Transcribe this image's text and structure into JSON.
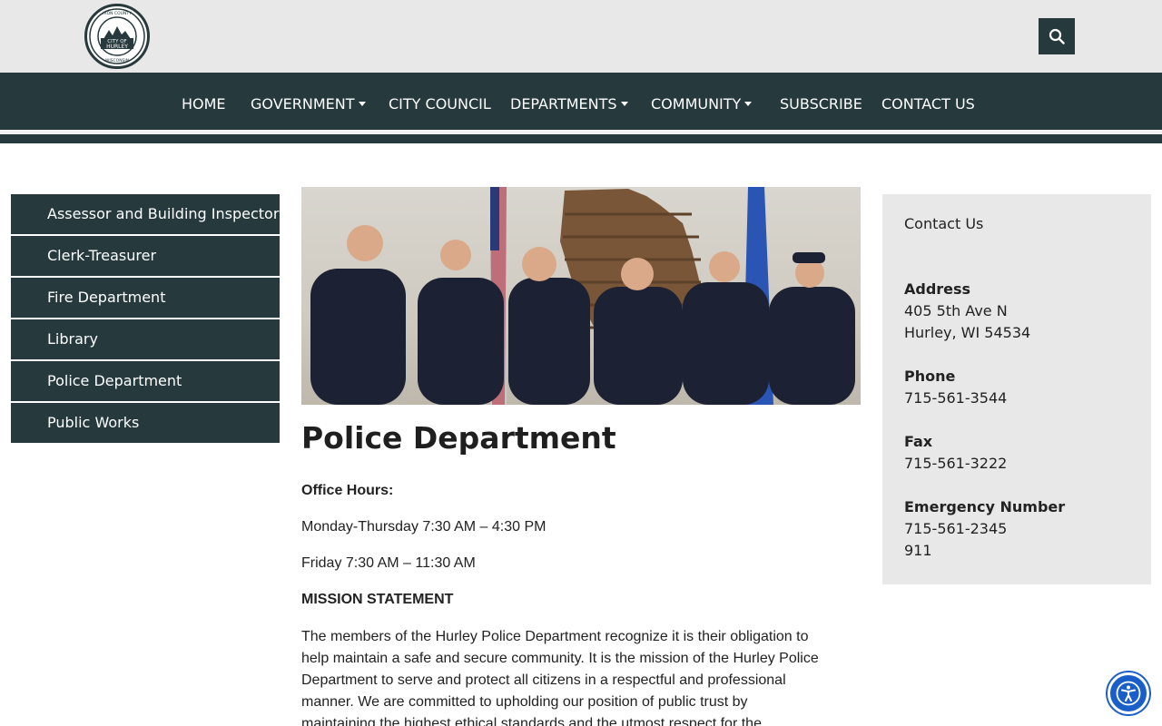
{
  "header": {
    "logo": {
      "top_text": "IRON COUNTY",
      "middle_text_1": "CITY OF",
      "middle_text_2": "HURLEY",
      "bottom_text": "WISCONSIN"
    },
    "search_icon": "search-icon"
  },
  "nav": {
    "items": [
      {
        "label": "HOME",
        "dropdown": false
      },
      {
        "label": "GOVERNMENT",
        "dropdown": true
      },
      {
        "label": "CITY COUNCIL",
        "dropdown": false
      },
      {
        "label": "DEPARTMENTS",
        "dropdown": true
      },
      {
        "label": "COMMUNITY",
        "dropdown": true
      },
      {
        "label": "SUBSCRIBE",
        "dropdown": false
      },
      {
        "label": "CONTACT US",
        "dropdown": false
      }
    ]
  },
  "sidebar": {
    "items": [
      {
        "label": "Assessor and Building Inspector"
      },
      {
        "label": "Clerk-Treasurer"
      },
      {
        "label": "Fire Department"
      },
      {
        "label": "Library"
      },
      {
        "label": "Police Department"
      },
      {
        "label": "Public Works"
      }
    ]
  },
  "main": {
    "title": "Police Department",
    "office_hours_label": "Office Hours:",
    "hours_weekday": "Monday-Thursday 7:30 AM – 4:30 PM",
    "hours_friday": "Friday 7:30 AM – 11:30 AM",
    "mission_label": "MISSION STATEMENT",
    "mission_lines": [
      "The members of the Hurley Police Department recognize it is their obligation to",
      "help maintain a safe and secure community. It is the mission of the Hurley Police",
      "Department to serve and protect all citizens in a respectful and professional",
      "manner. We are committed to upholding our position of public trust by",
      "maintaining the highest ethical standards and the utmost respect for the"
    ]
  },
  "contact": {
    "heading": "Contact Us",
    "address_label": "Address",
    "address_line1": "405 5th Ave N",
    "address_line2": "Hurley, WI 54534",
    "phone_label": "Phone",
    "phone": "715-561-3544",
    "fax_label": "Fax",
    "fax": "715-561-3222",
    "emergency_label": "Emergency Number",
    "emergency_1": "715-561-2345",
    "emergency_2": "911"
  },
  "colors": {
    "nav_bg": "#26393d",
    "topbar_bg": "#e8e8e8",
    "accessibility_blue": "#1a5ec9"
  },
  "accessibility_icon": "accessibility-icon"
}
